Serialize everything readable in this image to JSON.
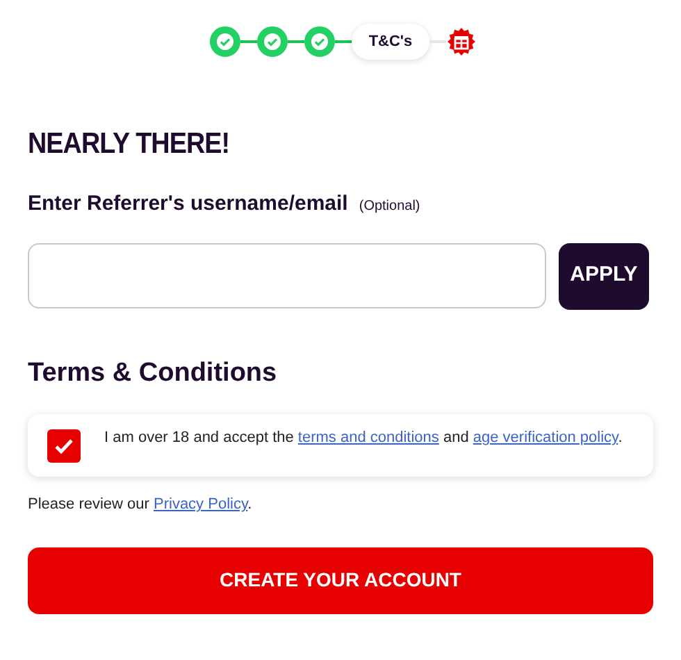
{
  "steps": [
    {
      "kind": "done"
    },
    {
      "kind": "done"
    },
    {
      "kind": "done"
    },
    {
      "kind": "current",
      "label": "T&C's"
    },
    {
      "kind": "pending"
    }
  ],
  "heading": "NEARLY THERE!",
  "referrer": {
    "label": "Enter Referrer's username/email",
    "note": "(Optional)",
    "button": "APPLY"
  },
  "terms": {
    "title": "Terms & Conditions",
    "checked": true,
    "parts": [
      {
        "kind": "text",
        "text": "I am over 18 and accept the "
      },
      {
        "kind": "link",
        "text": "terms and conditions"
      },
      {
        "kind": "text",
        "text": " and "
      },
      {
        "kind": "link",
        "text": "age verification policy"
      },
      {
        "kind": "text",
        "text": "."
      }
    ]
  },
  "privacy": [
    {
      "kind": "text",
      "text": "Please review our "
    },
    {
      "kind": "link",
      "text": "Privacy Policy"
    },
    {
      "kind": "text",
      "text": "."
    }
  ],
  "submit": "CREATE YOUR ACCOUNT"
}
